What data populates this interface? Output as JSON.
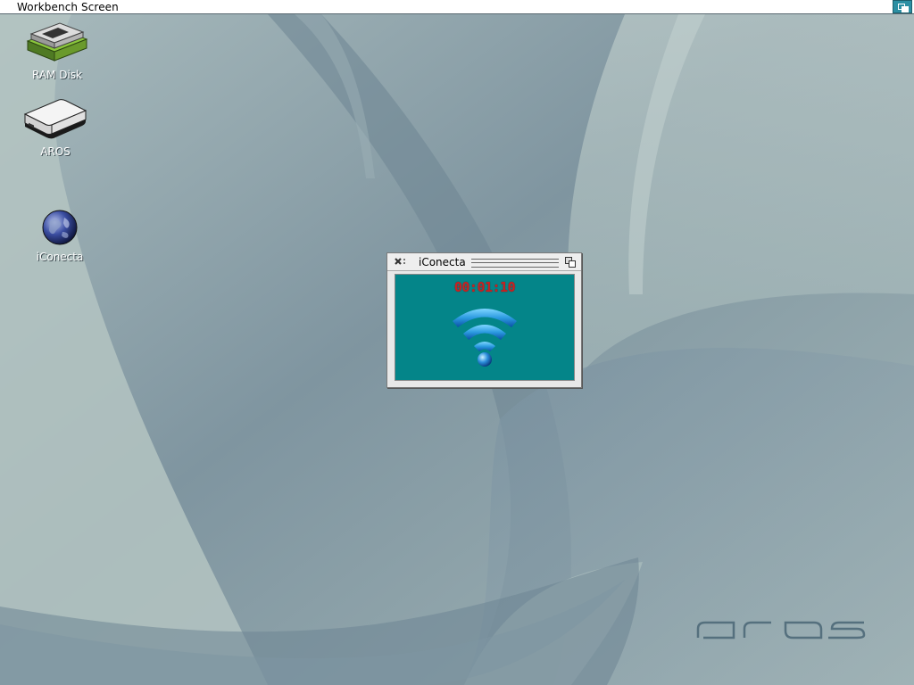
{
  "screen": {
    "title": "Workbench Screen",
    "depth_icon": "screen-depth-icon"
  },
  "desktop": {
    "icons": [
      {
        "label": "RAM Disk",
        "icon": "ram-disk-icon"
      },
      {
        "label": "AROS",
        "icon": "hard-drive-icon"
      },
      {
        "label": "iConecta",
        "icon": "globe-icon"
      }
    ],
    "logo": "aros"
  },
  "window": {
    "title": "iConecta",
    "close_icon": "close-icon",
    "depth_icon": "window-depth-icon",
    "timer": "00:01:10",
    "status_icon": "wifi-icon",
    "colors": {
      "content_bg": "#048589",
      "timer": "#c72222"
    }
  }
}
